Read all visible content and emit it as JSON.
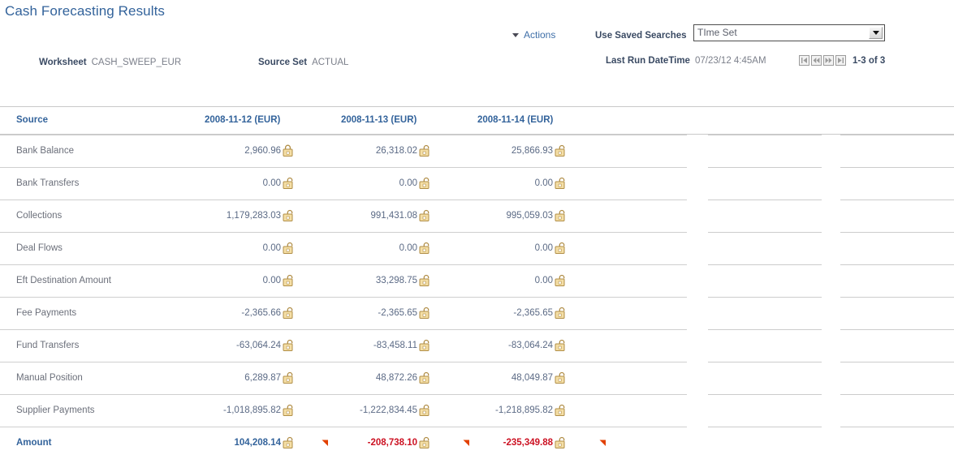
{
  "page": {
    "title": "Cash Forecasting Results"
  },
  "toolbar": {
    "actions_label": "Actions",
    "actions_icon": "caret-down-icon",
    "saved_search_label": "Use Saved Searches",
    "saved_search_value": "TIme Set"
  },
  "meta": {
    "worksheet_label": "Worksheet",
    "worksheet_value": "CASH_SWEEP_EUR",
    "source_set_label": "Source Set",
    "source_set_value": "ACTUAL",
    "last_run_label": "Last Run DateTime",
    "last_run_value": "07/23/12  4:45AM"
  },
  "pager": {
    "first_icon": "first-page-icon",
    "prev_icon": "previous-page-icon",
    "next_icon": "next-page-icon",
    "last_icon": "last-page-icon",
    "count": "1-3 of 3"
  },
  "colors": {
    "title": "#33639b",
    "link": "#33639b",
    "text": "#6b6f7a",
    "number": "#5b6a85",
    "negative": "#cc1122",
    "trend_down": "#e24000",
    "lock_body": "#f2d79b",
    "lock_outline": "#b08d46",
    "rule": "#c9c9c9"
  },
  "chart_data": {
    "type": "table",
    "title": "Cash Forecasting Results",
    "columns": [
      "Source",
      "2008-11-12 (EUR)",
      "2008-11-13 (EUR)",
      "2008-11-14 (EUR)"
    ],
    "rows": [
      {
        "source": "Bank Balance",
        "values": [
          "2,960.96",
          "26,318.02",
          "25,866.93"
        ],
        "numeric": [
          2960.96,
          26318.02,
          25866.93
        ],
        "locks": [
          "locked-icon",
          "unlocked-icon",
          "unlocked-icon"
        ],
        "trend": [
          null,
          null,
          null
        ],
        "total": false
      },
      {
        "source": "Bank Transfers",
        "values": [
          "0.00",
          "0.00",
          "0.00"
        ],
        "numeric": [
          0.0,
          0.0,
          0.0
        ],
        "locks": [
          "unlocked-icon",
          "unlocked-icon",
          "unlocked-icon"
        ],
        "trend": [
          null,
          null,
          null
        ],
        "total": false
      },
      {
        "source": "Collections",
        "values": [
          "1,179,283.03",
          "991,431.08",
          "995,059.03"
        ],
        "numeric": [
          1179283.03,
          991431.08,
          995059.03
        ],
        "locks": [
          "unlocked-icon",
          "unlocked-icon",
          "unlocked-icon"
        ],
        "trend": [
          null,
          null,
          null
        ],
        "total": false
      },
      {
        "source": "Deal Flows",
        "values": [
          "0.00",
          "0.00",
          "0.00"
        ],
        "numeric": [
          0.0,
          0.0,
          0.0
        ],
        "locks": [
          "unlocked-icon",
          "unlocked-icon",
          "unlocked-icon"
        ],
        "trend": [
          null,
          null,
          null
        ],
        "total": false
      },
      {
        "source": "Eft Destination Amount",
        "values": [
          "0.00",
          "33,298.75",
          "0.00"
        ],
        "numeric": [
          0.0,
          33298.75,
          0.0
        ],
        "locks": [
          "unlocked-icon",
          "unlocked-icon",
          "unlocked-icon"
        ],
        "trend": [
          null,
          null,
          null
        ],
        "total": false
      },
      {
        "source": "Fee Payments",
        "values": [
          "-2,365.66",
          "-2,365.65",
          "-2,365.65"
        ],
        "numeric": [
          -2365.66,
          -2365.65,
          -2365.65
        ],
        "locks": [
          "unlocked-icon",
          "unlocked-icon",
          "unlocked-icon"
        ],
        "trend": [
          null,
          null,
          null
        ],
        "total": false
      },
      {
        "source": "Fund Transfers",
        "values": [
          "-63,064.24",
          "-83,458.11",
          "-83,064.24"
        ],
        "numeric": [
          -63064.24,
          -83458.11,
          -83064.24
        ],
        "locks": [
          "unlocked-icon",
          "unlocked-icon",
          "unlocked-icon"
        ],
        "trend": [
          null,
          null,
          null
        ],
        "total": false
      },
      {
        "source": "Manual Position",
        "values": [
          "6,289.87",
          "48,872.26",
          "48,049.87"
        ],
        "numeric": [
          6289.87,
          48872.26,
          48049.87
        ],
        "locks": [
          "unlocked-icon",
          "unlocked-icon",
          "unlocked-icon"
        ],
        "trend": [
          null,
          null,
          null
        ],
        "total": false
      },
      {
        "source": "Supplier Payments",
        "values": [
          "-1,018,895.82",
          "-1,222,834.45",
          "-1,218,895.82"
        ],
        "numeric": [
          -1018895.82,
          -1222834.45,
          -1218895.82
        ],
        "locks": [
          "unlocked-icon",
          "unlocked-icon",
          "unlocked-icon"
        ],
        "trend": [
          null,
          null,
          null
        ],
        "total": false
      },
      {
        "source": "Amount",
        "values": [
          "104,208.14",
          "-208,738.10",
          "-235,349.88"
        ],
        "numeric": [
          104208.14,
          -208738.1,
          -235349.88
        ],
        "locks": [
          "unlocked-icon",
          "unlocked-icon",
          "unlocked-icon"
        ],
        "trend": [
          "trend-down-icon",
          "trend-down-icon",
          "trend-down-icon"
        ],
        "total": true
      }
    ]
  }
}
